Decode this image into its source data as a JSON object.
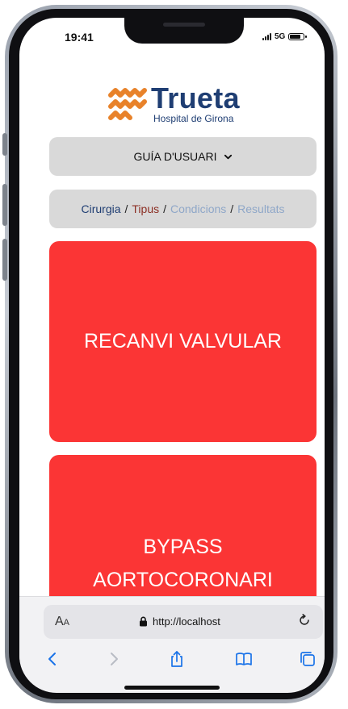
{
  "status_bar": {
    "time": "19:41",
    "network": "5G"
  },
  "logo": {
    "name": "Trueta",
    "subtitle": "Hospital de Girona"
  },
  "user_guide": {
    "label": "GUÍA D'USUARI"
  },
  "breadcrumb": {
    "items": [
      {
        "label": "Cirurgia",
        "color": "#1f3e73"
      },
      {
        "label": "Tipus",
        "color": "#8c2f24"
      },
      {
        "label": "Condicions",
        "color": "#8fa7c8"
      },
      {
        "label": "Resultats",
        "color": "#8fa7c8"
      }
    ],
    "separator": "/"
  },
  "cards": [
    {
      "label": "RECANVI VALVULAR"
    },
    {
      "line1": "BYPASS",
      "line2": "AORTOCORONARI"
    }
  ],
  "browser": {
    "text_size": "AA",
    "url": "http://localhost"
  },
  "colors": {
    "accent": "#fb3535",
    "brand_navy": "#1f3e73",
    "brand_orange": "#e8822a",
    "panel": "#d9d9d9"
  }
}
